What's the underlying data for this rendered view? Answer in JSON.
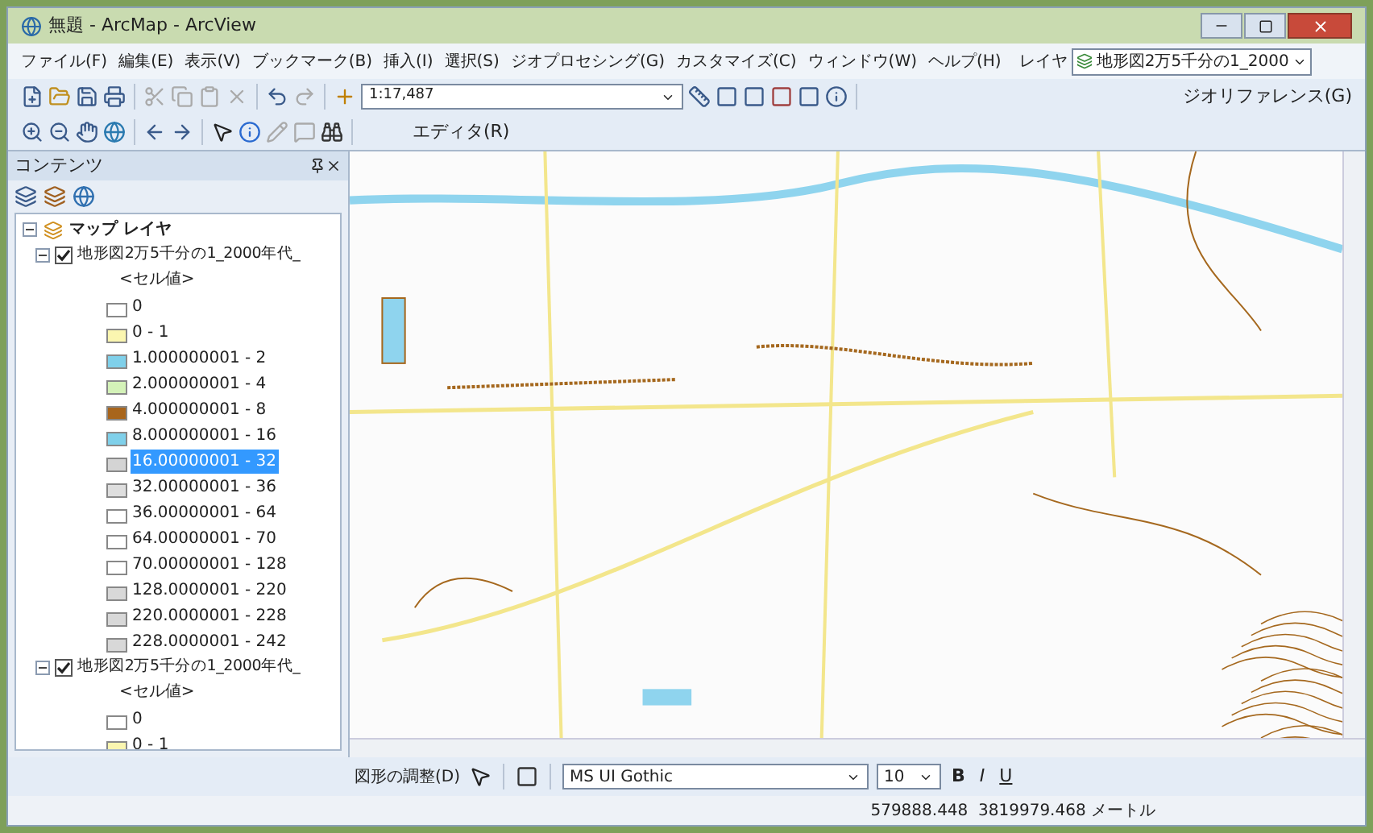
{
  "window": {
    "title": "無題 - ArcMap - ArcView"
  },
  "menu": [
    "ファイル(F)",
    "編集(E)",
    "表示(V)",
    "ブックマーク(B)",
    "挿入(I)",
    "選択(S)",
    "ジオプロセシング(G)",
    "カスタマイズ(C)",
    "ウィンドウ(W)",
    "ヘルプ(H)"
  ],
  "layer_picker": {
    "label": "レイヤ",
    "value": "地形図2万5千分の1_2000"
  },
  "standard_toolbar": {
    "scale": "1:17,487"
  },
  "georeferencing": {
    "label": "ジオリファレンス(G)"
  },
  "editor": {
    "label": "エディタ(R)"
  },
  "toc": {
    "title": "コンテンツ",
    "root": {
      "label": "マップ レイヤ",
      "expanded": true
    },
    "layers": [
      {
        "name": "地形図2万5千分の1_2000年代_",
        "checked": true,
        "expanded": true,
        "field": "<セル値>",
        "classes": [
          {
            "label": "0",
            "color": "#ffffff",
            "selected": false
          },
          {
            "label": "0 - 1",
            "color": "#fbf6b0",
            "selected": false
          },
          {
            "label": "1.000000001 - 2",
            "color": "#7fd0ea",
            "selected": false
          },
          {
            "label": "2.000000001 - 4",
            "color": "#d4f2b8",
            "selected": false
          },
          {
            "label": "4.000000001 - 8",
            "color": "#a8651c",
            "selected": false
          },
          {
            "label": "8.000000001 - 16",
            "color": "#7fd0ea",
            "selected": false
          },
          {
            "label": "16.00000001 - 32",
            "color": "#d4d4d4",
            "selected": true
          },
          {
            "label": "32.00000001 - 36",
            "color": "#dedede",
            "selected": false
          },
          {
            "label": "36.00000001 - 64",
            "color": "#ffffff",
            "selected": false
          },
          {
            "label": "64.00000001 - 70",
            "color": "#ffffff",
            "selected": false
          },
          {
            "label": "70.00000001 - 128",
            "color": "#ffffff",
            "selected": false
          },
          {
            "label": "128.0000001 - 220",
            "color": "#d8d8d8",
            "selected": false
          },
          {
            "label": "220.0000001 - 228",
            "color": "#d8d8d8",
            "selected": false
          },
          {
            "label": "228.0000001 - 242",
            "color": "#d8d8d8",
            "selected": false
          }
        ]
      },
      {
        "name": "地形図2万5千分の1_2000年代_",
        "checked": true,
        "expanded": true,
        "field": "<セル値>",
        "classes": [
          {
            "label": "0",
            "color": "#ffffff",
            "selected": false
          },
          {
            "label": "0 - 1",
            "color": "#fbf6b0",
            "selected": false
          }
        ]
      }
    ]
  },
  "drawing_toolbar": {
    "drawing_menu": "図形の調整(D)",
    "font": "MS UI Gothic",
    "size": "10",
    "bold": "B",
    "italic": "I",
    "underline": "U"
  },
  "status_bar": {
    "coordinates": "579888.448  3819979.468 メートル"
  }
}
